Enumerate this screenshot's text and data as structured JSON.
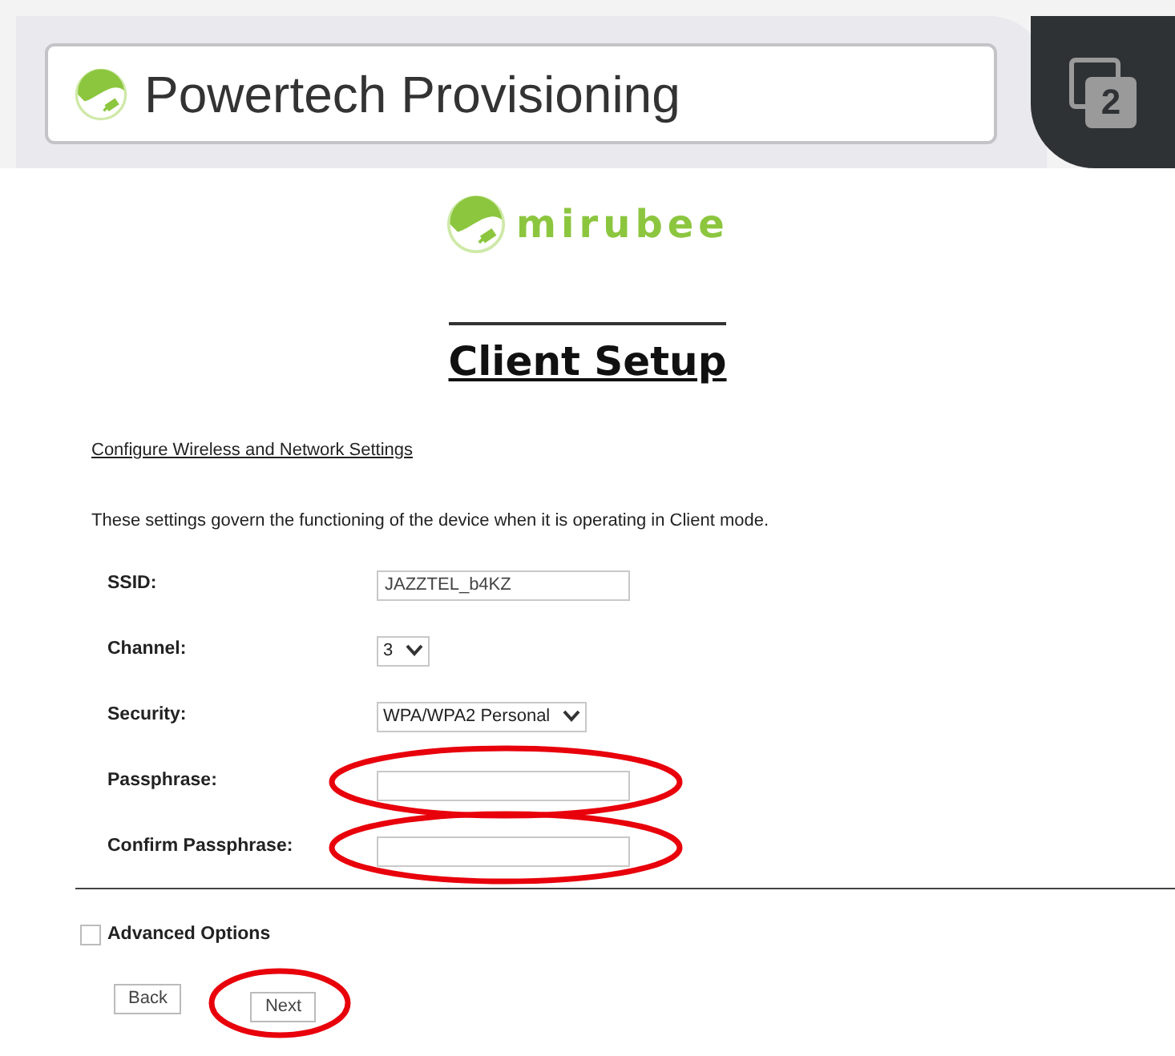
{
  "browser": {
    "tab_title": "Powertech Provisioning",
    "tab_count": "2"
  },
  "logo": {
    "text": "mirubee"
  },
  "title": "Client Setup",
  "section_heading": "Configure Wireless and Network Settings",
  "description": "These settings govern the functioning of the device when it is operating in Client mode.",
  "fields": [
    {
      "kind": "text",
      "label": "SSID:",
      "value": "JAZZTEL_b4KZ",
      "circled": false
    },
    {
      "kind": "select",
      "label": "Channel:",
      "value": "3",
      "circled": false
    },
    {
      "kind": "select",
      "label": "Security:",
      "value": "WPA/WPA2 Personal",
      "circled": false
    },
    {
      "kind": "password",
      "label": "Passphrase:",
      "circled": true
    },
    {
      "kind": "password",
      "label": "Confirm Passphrase:",
      "circled": true
    }
  ],
  "advanced_options": {
    "label": "Advanced Options",
    "checked": false
  },
  "buttons": [
    {
      "label": "Back",
      "circled": false
    },
    {
      "label": "Next",
      "circled": true
    }
  ]
}
